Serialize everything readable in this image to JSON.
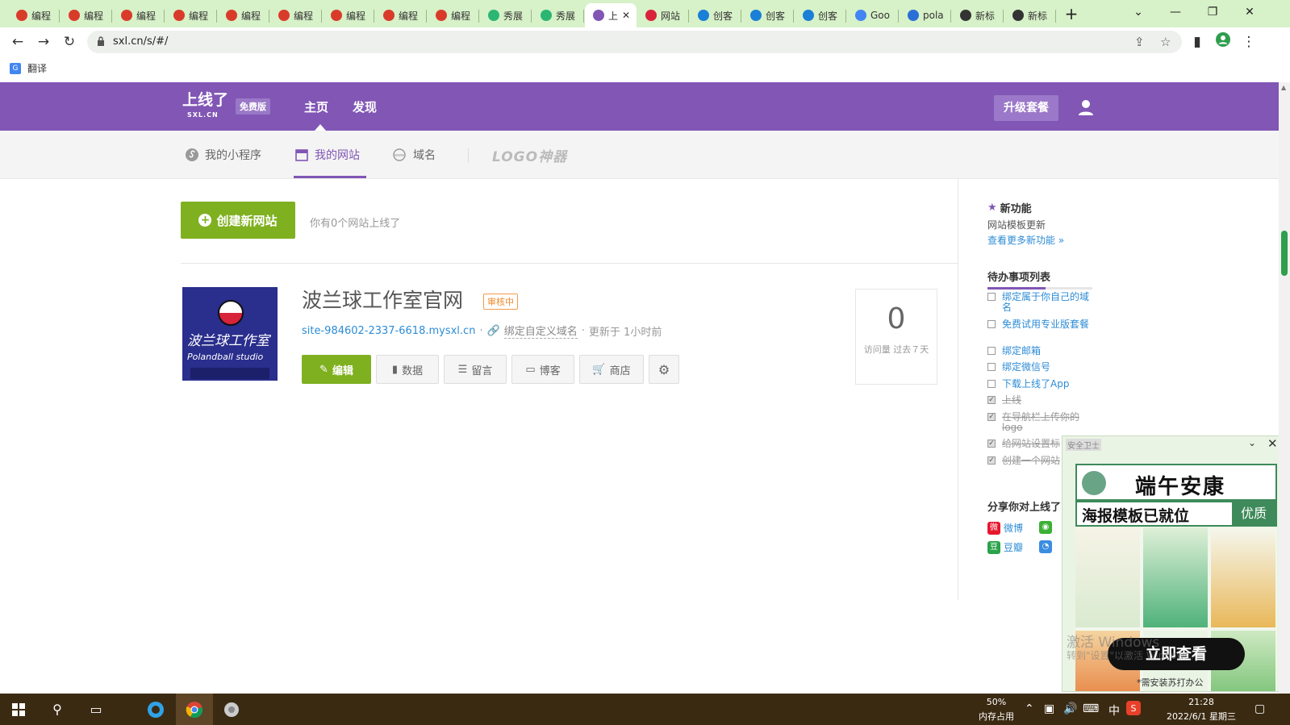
{
  "browser": {
    "tabs": [
      {
        "label": "编程",
        "icon": "red-hat-icon",
        "color": "#d93b2b"
      },
      {
        "label": "编程",
        "icon": "red-hat-icon",
        "color": "#d93b2b"
      },
      {
        "label": "编程",
        "icon": "red-hat-icon",
        "color": "#d93b2b"
      },
      {
        "label": "编程",
        "icon": "red-hat-icon",
        "color": "#d93b2b"
      },
      {
        "label": "编程",
        "icon": "red-hat-icon",
        "color": "#d93b2b"
      },
      {
        "label": "编程",
        "icon": "red-hat-icon",
        "color": "#d93b2b"
      },
      {
        "label": "编程",
        "icon": "red-hat-icon",
        "color": "#d93b2b"
      },
      {
        "label": "编程",
        "icon": "red-hat-icon",
        "color": "#d93b2b"
      },
      {
        "label": "编程",
        "icon": "red-hat-icon",
        "color": "#d93b2b"
      },
      {
        "label": "秀展",
        "icon": "leaf-icon",
        "color": "#2bb673"
      },
      {
        "label": "秀展",
        "icon": "leaf-icon",
        "color": "#2bb673"
      },
      {
        "label": "上",
        "icon": "s-logo-icon",
        "color": "#8156b5",
        "active": true
      },
      {
        "label": "网站",
        "icon": "polandball-icon",
        "color": "#d8233a"
      },
      {
        "label": "创客",
        "icon": "bird-icon",
        "color": "#1a7fd6"
      },
      {
        "label": "创客",
        "icon": "bird-icon",
        "color": "#1a7fd6"
      },
      {
        "label": "创客",
        "icon": "bird-icon",
        "color": "#1a7fd6"
      },
      {
        "label": "Goo",
        "icon": "translate-icon",
        "color": "#4285f4"
      },
      {
        "label": "pola",
        "icon": "bing-icon",
        "color": "#2a6fd6"
      },
      {
        "label": "新标",
        "icon": "globe-icon",
        "color": "#333333"
      },
      {
        "label": "新标",
        "icon": "globe-icon",
        "color": "#333333"
      }
    ],
    "new_tab": "+",
    "url": "sxl.cn/s/#/",
    "bookmark": "翻译"
  },
  "header": {
    "logo": "上线了",
    "logo_sub": "SXL.CN",
    "badge": "免费版",
    "nav": [
      "主页",
      "发现"
    ],
    "upgrade": "升级套餐"
  },
  "subnav": {
    "items": [
      "我的小程序",
      "我的网站",
      "域名"
    ],
    "logo_tool": "LOGO神器",
    "active": "我的网站"
  },
  "main": {
    "create_button": "创建新网站",
    "count_text": "你有0个网站上线了",
    "site": {
      "title": "波兰球工作室官网",
      "status": "审核中",
      "domain": "site-984602-2337-6618.mysxl.cn",
      "bind_domain": "绑定自定义域名",
      "updated": "更新于 1小时前",
      "thumb_title": "波兰球工作室",
      "thumb_sub": "Polandball studio",
      "buttons": [
        "编辑",
        "数据",
        "留言",
        "博客",
        "商店"
      ],
      "visits": "0",
      "visits_label": "访问量 过去７天"
    }
  },
  "sidebar": {
    "new_title": "新功能",
    "new_text": "网站模板更新",
    "new_link": "查看更多新功能 »",
    "todo_title": "待办事项列表",
    "todo_progress": 0.55,
    "todos": [
      {
        "text": "绑定属于你自己的域名",
        "done": false
      },
      {
        "text": "免费试用专业版套餐",
        "done": false
      },
      {
        "text": "绑定邮箱",
        "done": false
      },
      {
        "text": "绑定微信号",
        "done": false
      },
      {
        "text": "下载上线了App",
        "done": false
      },
      {
        "text": "上线",
        "done": true
      },
      {
        "text": "在导航栏上传你的logo",
        "done": true
      },
      {
        "text": "给网站设置标",
        "done": true
      },
      {
        "text": "创建一个网站",
        "done": true
      }
    ],
    "share_title": "分享你对上线了",
    "share": [
      "微博",
      "豆瓣"
    ]
  },
  "ad": {
    "brand": "安全卫士",
    "headline": "端午安康",
    "subline": "海报模板已就位",
    "tag": "优质",
    "cta": "立即查看",
    "note": "*需安装苏打办公"
  },
  "watermark": {
    "line1": "激活 Windows",
    "line2": "转到\"设置\"以激活 Windows。"
  },
  "taskbar": {
    "memory_pct": "50%",
    "memory_label": "内存占用",
    "ime": "中",
    "time": "21:28",
    "date": "2022/6/1 星期三"
  }
}
